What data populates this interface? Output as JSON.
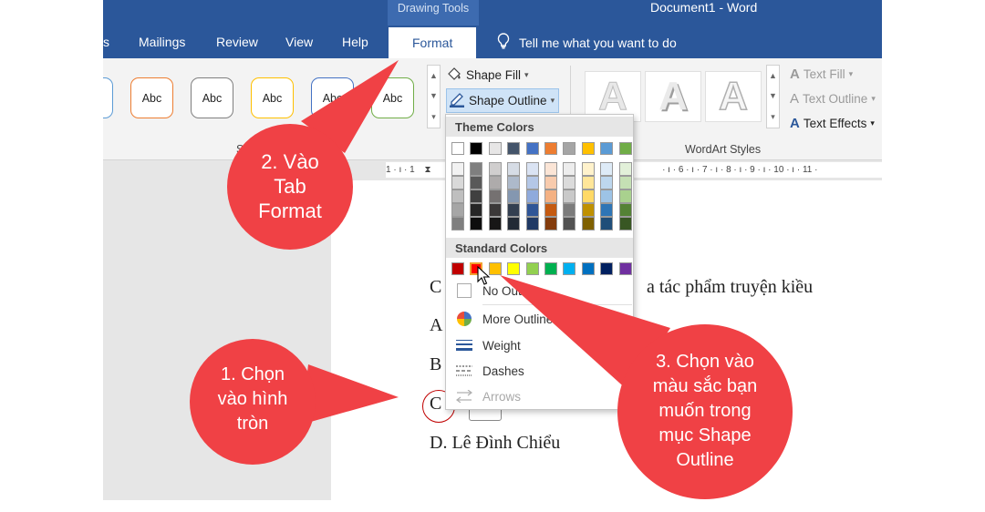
{
  "title_bar": {
    "contextual_tab_group": "Drawing Tools",
    "document_title": "Document1  -  Word"
  },
  "tabs": [
    {
      "label": "s"
    },
    {
      "label": "Mailings"
    },
    {
      "label": "Review"
    },
    {
      "label": "View"
    },
    {
      "label": "Help"
    },
    {
      "label": "Format",
      "active": true
    }
  ],
  "tell_me": "Tell me what you want to do",
  "ribbon": {
    "shape_styles": {
      "preset_label": "Abc",
      "preset_border_colors": [
        "#5b9bd5",
        "#ed7d31",
        "#7f7f7f",
        "#ffc000",
        "#4472c4",
        "#70ad47"
      ],
      "group_label_fragment": "S"
    },
    "shape_fill": "Shape Fill",
    "shape_outline": "Shape Outline",
    "wordart": {
      "sample_letter": "A",
      "text_fill": "Text Fill",
      "text_outline": "Text Outline",
      "text_effects": "Text Effects",
      "group_label": "WordArt Styles"
    }
  },
  "ruler": {
    "left_text": "1 · ı · 1",
    "right_text": "· ı · 6 · ı · 7 · ı · 8 · ı · 9 · ı · 10 · ı · 11 ·"
  },
  "document": {
    "lines": [
      {
        "label": "C",
        "tail": "a tác phẩm truyện kiều"
      },
      {
        "label": "A"
      },
      {
        "label": "B"
      },
      {
        "label": "C"
      },
      {
        "label": "D. Lê Đình Chiểu"
      }
    ]
  },
  "outline_dropdown": {
    "theme_colors_header": "Theme Colors",
    "theme_top_row": [
      "#ffffff",
      "#000000",
      "#e7e6e6",
      "#44546a",
      "#4472c4",
      "#ed7d31",
      "#a5a5a5",
      "#ffc000",
      "#5b9bd5",
      "#70ad47"
    ],
    "theme_shades": [
      [
        "#f2f2f2",
        "#7f7f7f",
        "#d0cece",
        "#d6dce5",
        "#dae3f3",
        "#fbe5d6",
        "#ededed",
        "#fff2cc",
        "#deebf7",
        "#e2f0d9"
      ],
      [
        "#d9d9d9",
        "#595959",
        "#aeabab",
        "#adb9ca",
        "#b4c7e7",
        "#f8cbad",
        "#dbdbdb",
        "#ffe699",
        "#bdd7ee",
        "#c5e0b4"
      ],
      [
        "#bfbfbf",
        "#404040",
        "#757171",
        "#8497b0",
        "#8faadc",
        "#f4b183",
        "#c9c9c9",
        "#ffd966",
        "#9dc3e6",
        "#a9d18e"
      ],
      [
        "#a6a6a6",
        "#262626",
        "#3b3838",
        "#333f50",
        "#2f5597",
        "#c55a11",
        "#7b7b7b",
        "#bf9000",
        "#2e75b6",
        "#548235"
      ],
      [
        "#7f7f7f",
        "#0d0d0d",
        "#171616",
        "#222a35",
        "#1f3864",
        "#843c0c",
        "#525252",
        "#7f6000",
        "#1f4e79",
        "#385723"
      ]
    ],
    "standard_colors_header": "Standard Colors",
    "standard_colors": [
      "#c00000",
      "#ff0000",
      "#ffc000",
      "#ffff00",
      "#92d050",
      "#00b050",
      "#00b0f0",
      "#0070c0",
      "#002060",
      "#7030a0"
    ],
    "selected_standard_index": 1,
    "items": {
      "no_outline": "No Outline",
      "more_outline_colors": "More Outline Colors...",
      "weight": "Weight",
      "dashes": "Dashes",
      "arrows": "Arrows"
    }
  },
  "callouts": {
    "step1": [
      "1. Chọn",
      "vào hình",
      "tròn"
    ],
    "step2": [
      "2. Vào",
      "Tab",
      "Format"
    ],
    "step3": [
      "3. Chọn vào",
      "màu sắc bạn",
      "muốn trong",
      "mục Shape",
      "Outline"
    ],
    "bubble_color": "#f04145"
  }
}
